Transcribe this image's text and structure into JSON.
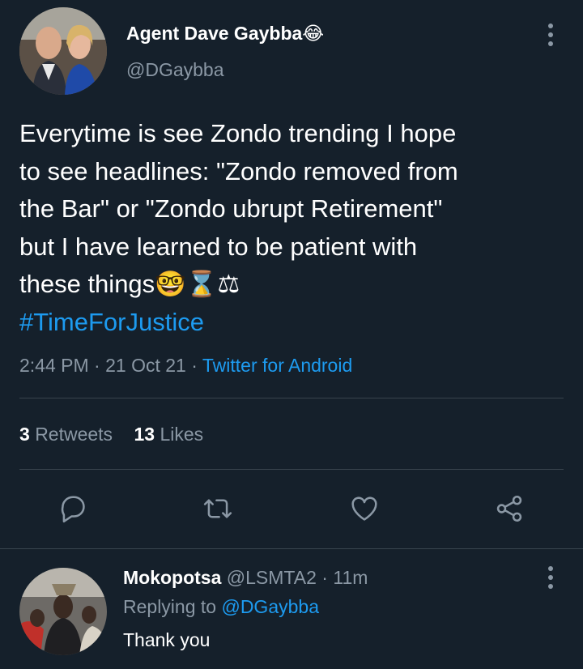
{
  "tweet": {
    "author_name": "Agent Dave Gaybba",
    "author_emoji": "😂",
    "handle": "@DGaybba",
    "lines": [
      "Everytime is see Zondo trending I hope",
      "to see headlines: \"Zondo removed from",
      "the Bar\" or \"Zondo ubrupt Retirement\"",
      "but I have learned to be patient with"
    ],
    "last_line_text": "these things",
    "last_line_emojis": "🤓⌛⚖",
    "hashtag": "#TimeForJustice",
    "time": "2:44 PM",
    "date": "21 Oct 21",
    "separator": "·",
    "source": "Twitter for Android",
    "retweets_count": "3",
    "retweets_label": "Retweets",
    "likes_count": "13",
    "likes_label": "Likes"
  },
  "actions": [
    "reply-icon",
    "retweet-icon",
    "like-icon",
    "share-icon"
  ],
  "reply": {
    "author_name": "Mokopotsa",
    "handle": "@LSMTA2",
    "separator": "·",
    "time": "11m",
    "replying_to_label": "Replying to",
    "replying_to_handle": "@DGaybba",
    "text": "Thank you"
  },
  "colors": {
    "background": "#15202b",
    "text": "#ffffff",
    "muted": "#8b98a5",
    "accent": "#1d9bf0",
    "divider": "#38444d"
  }
}
